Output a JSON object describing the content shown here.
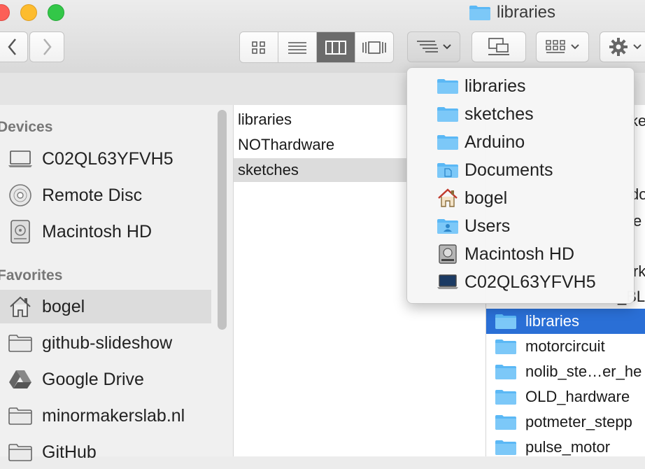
{
  "window": {
    "title": "libraries"
  },
  "toolbar": {
    "back_icon": "chevron-left-icon",
    "forward_icon": "chevron-right-icon",
    "view_modes": [
      "icon-view",
      "list-view",
      "column-view",
      "cover-flow-view"
    ],
    "selected_view": "column-view",
    "path_menu_icon": "path-list-icon",
    "share_icon": "network-share-icon",
    "arrange_icon": "arrange-grid-icon",
    "action_icon": "gear-icon"
  },
  "sidebar": {
    "devices_header": "Devices",
    "devices": [
      {
        "label": "C02QL63YFVH5",
        "icon": "laptop-icon"
      },
      {
        "label": "Remote Disc",
        "icon": "disc-icon"
      },
      {
        "label": "Macintosh HD",
        "icon": "hard-drive-icon"
      }
    ],
    "favorites_header": "Favorites",
    "favorites": [
      {
        "label": "bogel",
        "icon": "home-icon",
        "selected": true
      },
      {
        "label": "github-slideshow",
        "icon": "folder-icon"
      },
      {
        "label": "Google Drive",
        "icon": "google-drive-icon"
      },
      {
        "label": "minormakerslab.nl",
        "icon": "folder-icon"
      },
      {
        "label": "GitHub",
        "icon": "folder-icon"
      }
    ]
  },
  "column2": {
    "items": [
      {
        "label": "libraries"
      },
      {
        "label": "NOThardware"
      },
      {
        "label": "sketches",
        "selected": true
      }
    ]
  },
  "column3": {
    "visible_fragments": [
      "ke",
      "do",
      "e",
      "rk",
      "_BL"
    ],
    "items": [
      {
        "label": "libraries",
        "selected": true
      },
      {
        "label": "motorcircuit"
      },
      {
        "label": "nolib_ste…er_he"
      },
      {
        "label": "OLD_hardware"
      },
      {
        "label": "potmeter_stepp"
      },
      {
        "label": "pulse_motor"
      }
    ]
  },
  "path_menu": {
    "items": [
      {
        "label": "libraries",
        "icon": "folder-icon"
      },
      {
        "label": "sketches",
        "icon": "folder-icon"
      },
      {
        "label": "Arduino",
        "icon": "folder-icon"
      },
      {
        "label": "Documents",
        "icon": "documents-folder-icon"
      },
      {
        "label": "bogel",
        "icon": "home-icon"
      },
      {
        "label": "Users",
        "icon": "users-folder-icon"
      },
      {
        "label": "Macintosh HD",
        "icon": "hard-drive-icon"
      },
      {
        "label": "C02QL63YFVH5",
        "icon": "laptop-icon"
      }
    ]
  },
  "colors": {
    "selection_blue": "#2a6fd6",
    "folder_blue": "#5bb8f5",
    "close": "#fc5f57",
    "minimize": "#fdbc2e",
    "zoom": "#33c748"
  }
}
